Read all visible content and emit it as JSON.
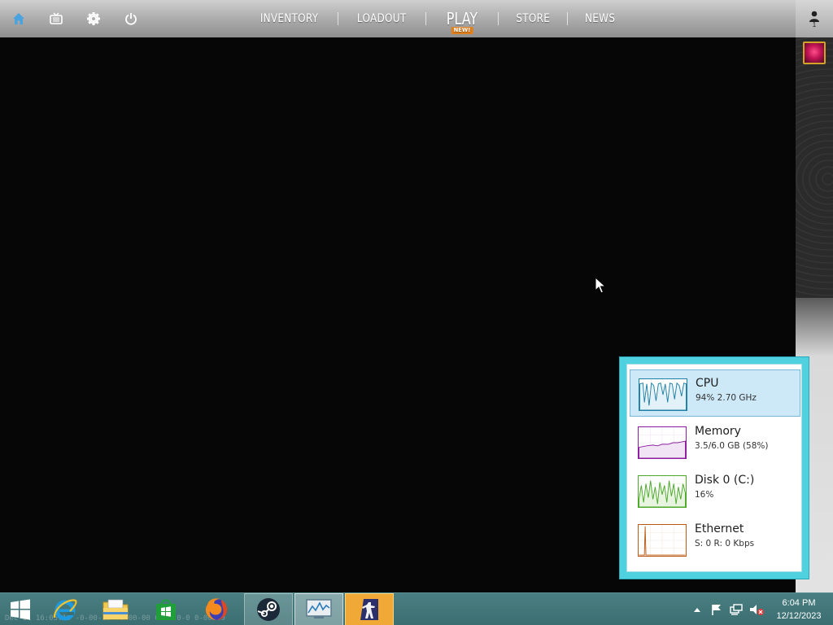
{
  "game_nav": {
    "items": [
      "INVENTORY",
      "LOADOUT"
    ],
    "play_label": "PLAY",
    "play_badge": "NEW!",
    "items_right": [
      "STORE",
      "NEWS"
    ],
    "friends_count": "1",
    "active_icon_color": "#4aa3df"
  },
  "task_manager": {
    "rows": [
      {
        "title": "CPU",
        "subtitle": "94%  2.70 GHz",
        "color": "#1f7fa6"
      },
      {
        "title": "Memory",
        "subtitle": "3.5/6.0 GB (58%)",
        "color": "#8b1c9e"
      },
      {
        "title": "Disk 0 (C:)",
        "subtitle": "16%",
        "color": "#4da82a"
      },
      {
        "title": "Ethernet",
        "subtitle": "S: 0  R: 0 Kbps",
        "color": "#b85a15"
      }
    ]
  },
  "taskbar": {
    "ghost_text": "Dec 11 16:05:15 -0-00-15- 0-00-00 0-14:0-0 0-00-99",
    "clock_time": "6:04 PM",
    "clock_date": "12/12/2023"
  }
}
